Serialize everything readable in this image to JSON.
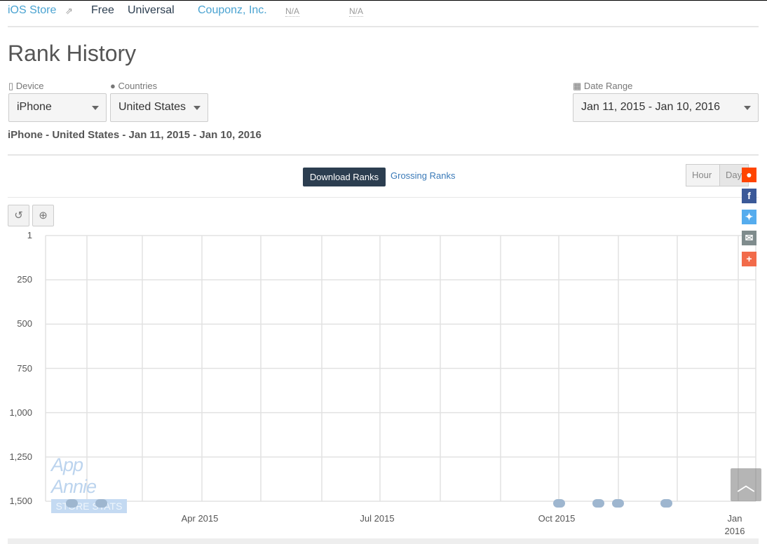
{
  "header": {
    "store_link": "iOS Store",
    "price": "Free",
    "platform": "Universal",
    "publisher": "Couponz, Inc.",
    "na1": "N/A",
    "na2": "N/A"
  },
  "title": "Rank History",
  "filters": {
    "device": {
      "label": "Device",
      "value": "iPhone"
    },
    "countries": {
      "label": "Countries",
      "value": "United States"
    },
    "date_range": {
      "label": "Date Range",
      "value": "Jan 11, 2015 - Jan 10, 2016"
    }
  },
  "subtitle": "iPhone - United States - Jan 11, 2015 - Jan 10, 2016",
  "tabs": {
    "download": "Download Ranks",
    "grossing": "Grossing Ranks",
    "hour": "Hour",
    "day": "Day"
  },
  "watermark": {
    "line1": "App Annie",
    "line2": "STORE STATS"
  },
  "colors": {
    "accent": "#2c3e50",
    "link": "#4aa3d1",
    "reddit": "#ff4500",
    "facebook": "#3b5998",
    "twitter": "#55acee",
    "email": "#7f8c8d",
    "more": "#f26b4a"
  },
  "chart_data": {
    "type": "line",
    "series": [],
    "y_ticks": [
      "1",
      "250",
      "500",
      "750",
      "1,000",
      "1,250",
      "1,500"
    ],
    "y_reversed": true,
    "ylim": [
      1,
      1500
    ],
    "x_ticks": [
      {
        "line1": "Apr 2015",
        "line2": ""
      },
      {
        "line1": "Jul 2015",
        "line2": ""
      },
      {
        "line1": "Oct 2015",
        "line2": ""
      },
      {
        "line1": "Jan",
        "line2": "2016"
      }
    ],
    "xlim": [
      "2015-01-11",
      "2016-01-10"
    ],
    "grid": true
  }
}
